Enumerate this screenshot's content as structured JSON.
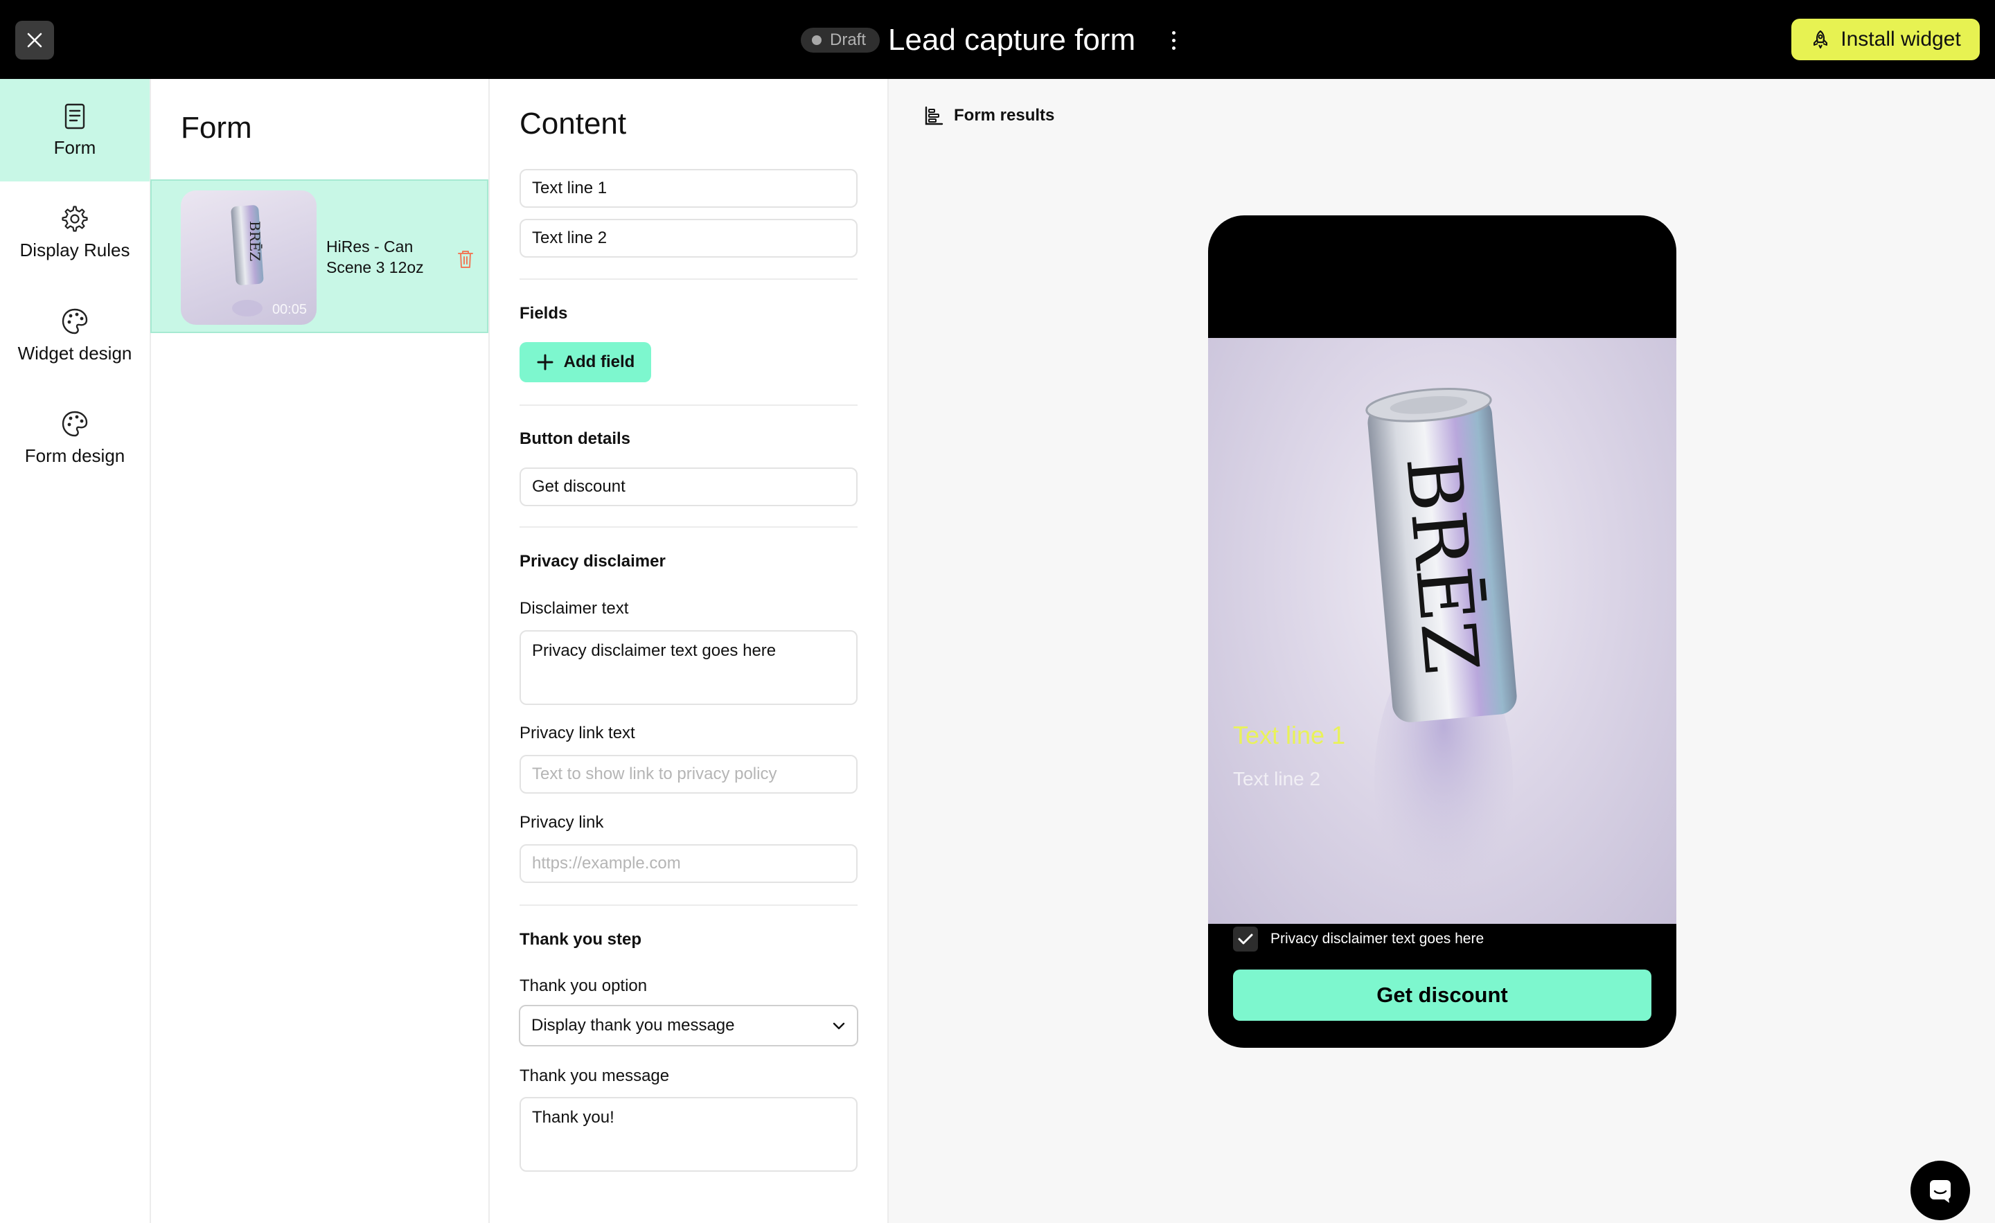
{
  "topbar": {
    "status": "Draft",
    "title": "Lead capture form",
    "install_label": "Install widget",
    "accent": "#e7f252"
  },
  "nav": {
    "items": [
      {
        "label": "Form",
        "icon": "document-icon",
        "active": true
      },
      {
        "label": "Display Rules",
        "icon": "gear-icon",
        "active": false
      },
      {
        "label": "Widget design",
        "icon": "palette-icon",
        "active": false
      },
      {
        "label": "Form design",
        "icon": "palette-icon",
        "active": false
      }
    ],
    "active_color": "#c8f7e6"
  },
  "form_panel": {
    "title": "Form",
    "media": {
      "name": "HiRes - Can Scene 3 12oz",
      "duration": "00:05",
      "product_text": "BRĒZ"
    }
  },
  "content": {
    "title": "Content",
    "text_line_1": "Text line 1",
    "text_line_2": "Text line 2",
    "fields_title": "Fields",
    "add_field_label": "Add field",
    "button_details_title": "Button details",
    "button_text": "Get discount",
    "privacy_title": "Privacy disclaimer",
    "disclaimer_label": "Disclaimer text",
    "disclaimer_value": "Privacy disclaimer text goes here",
    "privacy_link_text_label": "Privacy link text",
    "privacy_link_text_placeholder": "Text to show link to privacy policy",
    "privacy_link_label": "Privacy link",
    "privacy_link_placeholder": "https://example.com",
    "thank_you_title": "Thank you step",
    "thank_you_option_label": "Thank you option",
    "thank_you_option_value": "Display thank you message",
    "thank_you_message_label": "Thank you message",
    "thank_you_message_value": "Thank you!"
  },
  "preview": {
    "results_label": "Form results",
    "text_line_1": "Text line 1",
    "text_line_2": "Text line 2",
    "disclaimer": "Privacy disclaimer text goes here",
    "button": "Get discount",
    "product_text": "BRĒZ",
    "button_color": "#7df7ce",
    "text_line_1_color": "#e9f25a"
  }
}
